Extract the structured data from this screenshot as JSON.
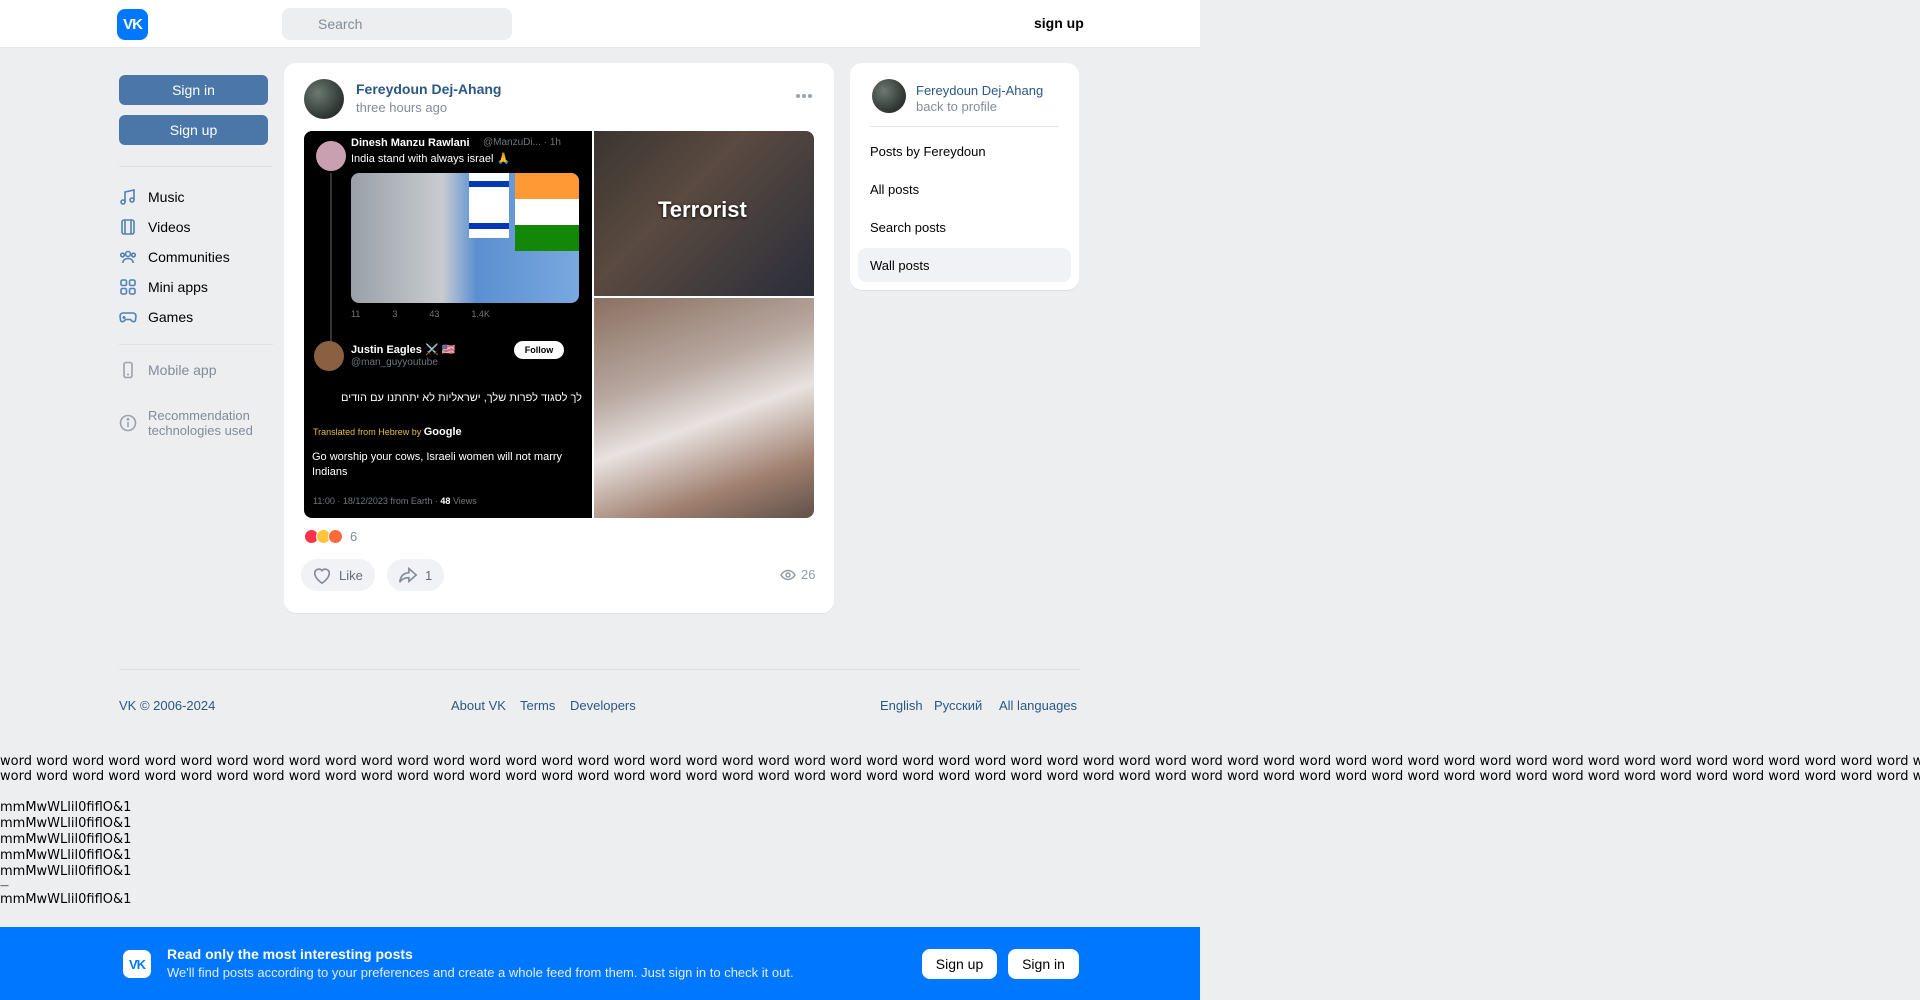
{
  "header": {
    "logo": "VK",
    "search_placeholder": "Search",
    "signup_label": "sign up"
  },
  "sidebar": {
    "sign_in": "Sign in",
    "sign_up": "Sign up",
    "items": [
      {
        "label": "Music",
        "icon": "music-icon"
      },
      {
        "label": "Videos",
        "icon": "video-icon"
      },
      {
        "label": "Communities",
        "icon": "communities-icon"
      },
      {
        "label": "Mini apps",
        "icon": "mini-apps-icon"
      },
      {
        "label": "Games",
        "icon": "gamepad-icon"
      }
    ],
    "mobile_app": "Mobile app",
    "recommendation": "Recommendation technologies used",
    "recommendation_line1": "Recommendation",
    "recommendation_line2": "technologies used"
  },
  "post": {
    "author": "Fereydoun Dej-Ahang",
    "time": "three hours ago",
    "tweet1": {
      "name": "Dinesh Manzu Rawlani",
      "handle": "@ManzuDi... · 1h",
      "text": "India stand with always israel 🙏",
      "actions": [
        "11",
        "3",
        "43",
        "1.4K"
      ]
    },
    "tweet2": {
      "name": "Justin Eagles ⚔️ 🇺🇸",
      "handle": "@man_guyyoutube",
      "follow": "Follow",
      "hebrew": "לך לסגוד לפרות שלך, ישראליות לא יתחתנו עם הודים",
      "translated_prefix": "Translated from Hebrew by",
      "translated_brand": "Google",
      "english": "Go worship your cows, Israeli women will not marry Indians",
      "meta_prefix": "11:00 · 18/12/2023 from Earth ·",
      "meta_views": "48",
      "meta_suffix": "Views"
    },
    "image2_caption": "Terrorist",
    "reaction_count": "6",
    "like_label": "Like",
    "share_count": "1",
    "views": "26"
  },
  "right_panel": {
    "name": "Fereydoun Dej-Ahang",
    "back": "back to profile",
    "items": [
      "Posts by Fereydoun",
      "All posts",
      "Search posts",
      "Wall posts"
    ]
  },
  "footer": {
    "copyright": "VK © 2006-2024",
    "about": "About VK",
    "terms": "Terms",
    "developers": "Developers",
    "english": "English",
    "russian": "Русский",
    "all_languages": "All languages"
  },
  "test_text": {
    "word_line": "word word word word word word word word word word word word word word word word word word word word word word word word word word word word word word word word word word word word word word word word word word word word word word word word word word word word word word word word word word word word word word word word word word word word word word word word word word word",
    "mm_line": "mmMwWLlil0fiflO&1",
    "dash": "—"
  },
  "banner": {
    "logo": "VK",
    "title": "Read only the most interesting posts",
    "subtitle": "We'll find posts according to your preferences and create a whole feed from them. Just sign in to check it out.",
    "sign_up": "Sign up",
    "sign_in": "Sign in"
  },
  "colors": {
    "accent": "#0077ff",
    "button": "#4a76a8",
    "link": "#2a5885"
  }
}
